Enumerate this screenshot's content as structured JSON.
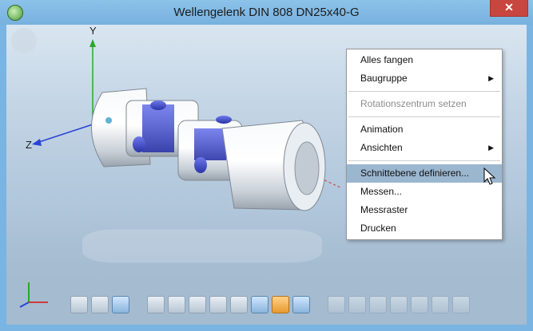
{
  "window": {
    "title": "Wellengelenk DIN 808 DN25x40-G",
    "close_label": "✕"
  },
  "viewport": {
    "axes": {
      "y": "Y",
      "z": "Z"
    }
  },
  "context_menu": {
    "items": [
      {
        "label": "Alles fangen",
        "enabled": true,
        "submenu": false
      },
      {
        "label": "Baugruppe",
        "enabled": true,
        "submenu": true
      },
      {
        "separator": true
      },
      {
        "label": "Rotationszentrum setzen",
        "enabled": false,
        "submenu": false
      },
      {
        "separator": true
      },
      {
        "label": "Animation",
        "enabled": true,
        "submenu": false
      },
      {
        "label": "Ansichten",
        "enabled": true,
        "submenu": true
      },
      {
        "separator": true
      },
      {
        "label": "Schnittebene definieren...",
        "enabled": true,
        "submenu": false,
        "highlighted": true
      },
      {
        "label": "Messen...",
        "enabled": true,
        "submenu": false
      },
      {
        "label": "Messraster",
        "enabled": true,
        "submenu": false
      },
      {
        "label": "Drucken",
        "enabled": true,
        "submenu": false
      }
    ]
  },
  "toolbar": {
    "icons": [
      "cylinder-outline-icon",
      "cylinder-light-icon",
      "cylinder-dark-icon",
      "zoom-icon",
      "zoom-window-icon",
      "rotate-icon",
      "dimensions-icon",
      "wireframe-icon",
      "render-icon",
      "color-cube-icon",
      "shaded-cube-icon",
      "view-cube-1-icon",
      "view-cube-2-icon",
      "view-cube-3-icon",
      "view-cube-4-icon",
      "view-cube-5-icon",
      "view-cube-6-icon",
      "view-cube-7-icon"
    ]
  },
  "colors": {
    "accent_highlight": "#9bb6cf",
    "part_blue": "#3d4bd0",
    "close_red": "#c7463f"
  }
}
